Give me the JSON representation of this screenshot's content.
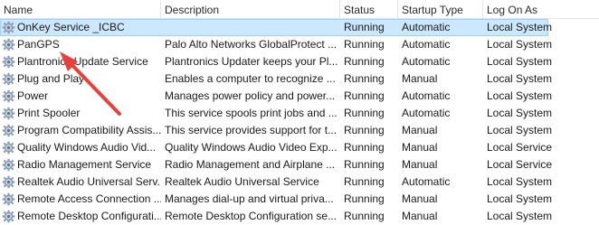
{
  "columns": {
    "name": "Name",
    "description": "Description",
    "status": "Status",
    "startup_type": "Startup Type",
    "log_on_as": "Log On As"
  },
  "services": [
    {
      "name": "OnKey Service _ICBC",
      "description": "",
      "status": "Running",
      "startup": "Automatic",
      "logon": "Local System",
      "selected": true
    },
    {
      "name": "PanGPS",
      "description": "Palo Alto Networks GlobalProtect ...",
      "status": "Running",
      "startup": "Automatic",
      "logon": "Local System"
    },
    {
      "name": "Plantronics Update Service",
      "description": "Plantronics Updater keeps your Pl...",
      "status": "Running",
      "startup": "Automatic",
      "logon": "Local System"
    },
    {
      "name": "Plug and Play",
      "description": "Enables a computer to recognize ...",
      "status": "Running",
      "startup": "Manual",
      "logon": "Local System"
    },
    {
      "name": "Power",
      "description": "Manages power policy and power...",
      "status": "Running",
      "startup": "Automatic",
      "logon": "Local System"
    },
    {
      "name": "Print Spooler",
      "description": "This service spools print jobs and ...",
      "status": "Running",
      "startup": "Automatic",
      "logon": "Local System"
    },
    {
      "name": "Program Compatibility Assis...",
      "description": "This service provides support for t...",
      "status": "Running",
      "startup": "Manual",
      "logon": "Local System"
    },
    {
      "name": "Quality Windows Audio Vid...",
      "description": "Quality Windows Audio Video Exp...",
      "status": "Running",
      "startup": "Manual",
      "logon": "Local Service"
    },
    {
      "name": "Radio Management Service",
      "description": "Radio Management and Airplane ...",
      "status": "Running",
      "startup": "Manual",
      "logon": "Local Service"
    },
    {
      "name": "Realtek Audio Universal Serv...",
      "description": "Realtek Audio Universal Service",
      "status": "Running",
      "startup": "Automatic",
      "logon": "Local System"
    },
    {
      "name": "Remote Access Connection ...",
      "description": "Manages dial-up and virtual priva...",
      "status": "Running",
      "startup": "Manual",
      "logon": "Local System"
    },
    {
      "name": "Remote Desktop Configurati...",
      "description": "Remote Desktop Configuration se...",
      "status": "Running",
      "startup": "Manual",
      "logon": "Local System"
    }
  ],
  "colors": {
    "selection": "#cce8ff",
    "selection_border": "#99d1ff",
    "annotation_arrow": "#e8413b"
  },
  "icons": {
    "service": "gear-icon",
    "annotation": "red-arrow-annotation"
  }
}
